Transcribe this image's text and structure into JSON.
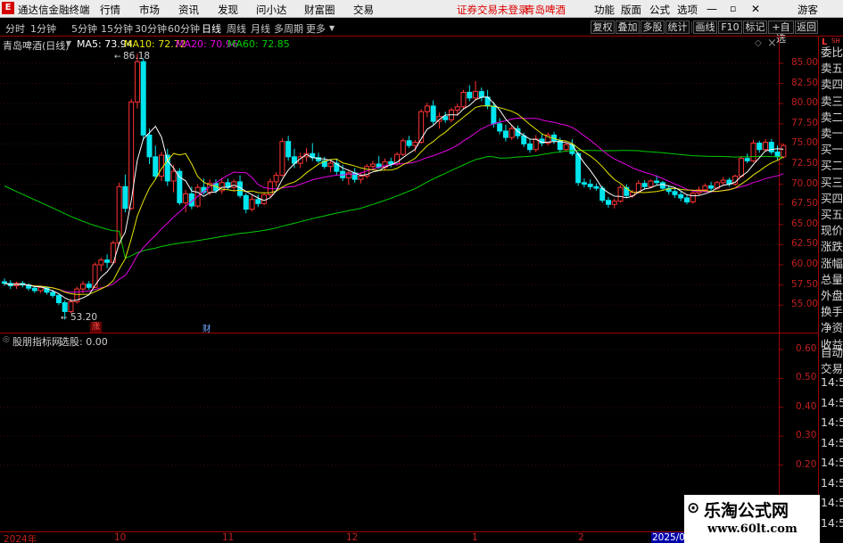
{
  "app": {
    "title": "通达信金融终端",
    "menu": [
      "行情",
      "市场",
      "资讯",
      "发现",
      "问小达",
      "财富圈",
      "交易"
    ],
    "notice": "证券交易未登录",
    "stock_name_header": "青岛啤酒",
    "right_menu": [
      "功能",
      "版面",
      "公式",
      "选项"
    ],
    "guest": "游客"
  },
  "toolbar": {
    "periods": [
      "分时",
      "1分钟",
      "5分钟",
      "15分钟",
      "30分钟",
      "60分钟",
      "日线",
      "周线",
      "月线",
      "多周期",
      "更多"
    ],
    "active_period": "日线",
    "right_buttons": [
      "复权",
      "叠加",
      "多股",
      "统计",
      "画线",
      "F10",
      "标记",
      "+自选",
      "返回"
    ]
  },
  "chart_info": {
    "stock": "青岛啤酒(日线)",
    "ma5": "MA5: 73.94",
    "ma10": "MA10: 72.72",
    "ma20": "MA20: 70.96",
    "ma60": "MA60: 72.85",
    "colors": {
      "ma5": "#ffffff",
      "ma10": "#e6e600",
      "ma20": "#e600e6",
      "ma60": "#00cc00",
      "up": "#ff3333",
      "down": "#00e5ee"
    },
    "high_mark": "86.18",
    "low_mark": "53.20",
    "event_up": "涨",
    "event_fin": "财"
  },
  "indicator": {
    "name": "股朋指标网",
    "value": "选股: 0.00"
  },
  "chart_data": [
    {
      "type": "candlestick",
      "title": "青岛啤酒(日线)",
      "yticks": [
        "85.00",
        "82.50",
        "80.00",
        "77.50",
        "75.00",
        "72.50",
        "70.00",
        "67.50",
        "65.00",
        "62.50",
        "60.00",
        "57.50",
        "55.00"
      ],
      "xlabels": [
        "2024年",
        "10",
        "11",
        "12",
        "1",
        "2",
        "2025/02"
      ],
      "series": [
        {
          "name": "MA5",
          "value": "73.94"
        },
        {
          "name": "MA10",
          "value": "72.72"
        },
        {
          "name": "MA20",
          "value": "70.96"
        },
        {
          "name": "MA60",
          "value": "72.85"
        }
      ],
      "candles": [
        [
          57.9,
          58.3,
          57.4,
          57.7
        ],
        [
          57.7,
          58.1,
          57.0,
          57.4
        ],
        [
          57.4,
          57.9,
          57.0,
          57.7
        ],
        [
          57.7,
          58.0,
          57.2,
          57.5
        ],
        [
          57.5,
          57.7,
          56.8,
          57.1
        ],
        [
          57.1,
          57.4,
          56.5,
          56.8
        ],
        [
          56.8,
          57.4,
          56.5,
          57.2
        ],
        [
          57.2,
          57.3,
          56.3,
          56.6
        ],
        [
          56.6,
          56.9,
          55.9,
          56.2
        ],
        [
          56.2,
          56.4,
          55.0,
          55.3
        ],
        [
          55.3,
          55.6,
          53.2,
          54.2
        ],
        [
          54.2,
          55.8,
          54.0,
          55.4
        ],
        [
          55.4,
          57.3,
          55.2,
          57.0
        ],
        [
          57.0,
          58.0,
          56.5,
          57.6
        ],
        [
          57.6,
          58.0,
          56.9,
          57.2
        ],
        [
          57.2,
          60.3,
          57.1,
          60.0
        ],
        [
          60.0,
          60.9,
          59.2,
          60.6
        ],
        [
          60.6,
          61.3,
          59.6,
          60.3
        ],
        [
          60.3,
          63.0,
          60.1,
          62.7
        ],
        [
          62.7,
          70.2,
          62.4,
          69.7
        ],
        [
          69.7,
          71.2,
          66.5,
          67.0
        ],
        [
          67.0,
          80.6,
          66.8,
          80.2
        ],
        [
          80.2,
          86.18,
          79.4,
          85.2
        ],
        [
          85.2,
          85.6,
          75.4,
          76.1
        ],
        [
          76.1,
          76.9,
          72.5,
          73.4
        ],
        [
          73.4,
          74.8,
          70.6,
          71.0
        ],
        [
          71.0,
          74.0,
          70.4,
          73.6
        ],
        [
          73.6,
          74.4,
          69.8,
          70.4
        ],
        [
          70.4,
          72.4,
          69.0,
          71.6
        ],
        [
          71.6,
          72.0,
          67.4,
          67.7
        ],
        [
          67.7,
          69.3,
          66.5,
          68.8
        ],
        [
          68.8,
          69.7,
          66.9,
          67.3
        ],
        [
          67.3,
          70.0,
          67.1,
          69.6
        ],
        [
          69.6,
          70.7,
          68.7,
          69.0
        ],
        [
          69.0,
          70.6,
          68.6,
          70.1
        ],
        [
          70.1,
          70.6,
          68.9,
          69.2
        ],
        [
          69.2,
          70.8,
          68.8,
          70.2
        ],
        [
          70.2,
          70.7,
          69.3,
          69.6
        ],
        [
          69.6,
          70.6,
          69.1,
          70.3
        ],
        [
          70.3,
          71.1,
          68.3,
          68.6
        ],
        [
          68.6,
          68.9,
          66.4,
          66.9
        ],
        [
          66.9,
          68.6,
          66.6,
          68.1
        ],
        [
          68.1,
          68.7,
          67.2,
          67.6
        ],
        [
          67.6,
          69.0,
          67.4,
          68.7
        ],
        [
          68.7,
          70.7,
          68.4,
          70.3
        ],
        [
          70.3,
          71.5,
          69.7,
          71.1
        ],
        [
          71.1,
          75.7,
          70.9,
          75.3
        ],
        [
          75.3,
          76.0,
          72.9,
          73.4
        ],
        [
          73.4,
          74.4,
          72.0,
          72.6
        ],
        [
          72.6,
          73.9,
          72.0,
          73.4
        ],
        [
          73.4,
          74.5,
          72.8,
          73.8
        ],
        [
          73.8,
          75.1,
          72.9,
          73.3
        ],
        [
          73.3,
          73.9,
          72.6,
          72.9
        ],
        [
          72.9,
          73.4,
          71.9,
          72.2
        ],
        [
          72.2,
          73.0,
          71.5,
          72.6
        ],
        [
          72.6,
          73.2,
          71.2,
          71.6
        ],
        [
          71.6,
          72.4,
          70.4,
          70.8
        ],
        [
          70.8,
          71.8,
          69.9,
          71.4
        ],
        [
          71.4,
          72.0,
          70.2,
          70.6
        ],
        [
          70.6,
          71.5,
          70.1,
          71.0
        ],
        [
          71.0,
          72.5,
          70.7,
          72.2
        ],
        [
          72.2,
          72.9,
          71.8,
          72.5
        ],
        [
          72.5,
          73.5,
          71.9,
          72.1
        ],
        [
          72.1,
          73.2,
          71.7,
          72.8
        ],
        [
          72.8,
          73.3,
          72.1,
          72.5
        ],
        [
          72.5,
          74.0,
          72.3,
          73.7
        ],
        [
          73.7,
          75.7,
          73.5,
          75.4
        ],
        [
          75.4,
          76.0,
          74.5,
          74.8
        ],
        [
          74.8,
          75.5,
          74.0,
          75.2
        ],
        [
          75.2,
          79.3,
          75.0,
          79.0
        ],
        [
          79.0,
          80.1,
          78.3,
          79.7
        ],
        [
          79.7,
          80.4,
          77.4,
          77.8
        ],
        [
          77.8,
          78.9,
          76.9,
          78.4
        ],
        [
          78.4,
          79.0,
          77.6,
          78.0
        ],
        [
          78.0,
          79.5,
          77.7,
          79.2
        ],
        [
          79.2,
          80.0,
          78.5,
          79.6
        ],
        [
          79.6,
          81.7,
          79.3,
          81.4
        ],
        [
          81.4,
          82.3,
          80.3,
          80.7
        ],
        [
          80.7,
          82.8,
          80.4,
          81.5
        ],
        [
          81.5,
          82.0,
          80.3,
          80.8
        ],
        [
          80.8,
          81.7,
          79.3,
          79.7
        ],
        [
          79.7,
          80.2,
          77.0,
          77.5
        ],
        [
          77.5,
          78.2,
          76.2,
          76.6
        ],
        [
          76.6,
          77.4,
          75.3,
          75.8
        ],
        [
          75.8,
          77.2,
          75.5,
          76.9
        ],
        [
          76.9,
          77.3,
          75.6,
          76.0
        ],
        [
          76.0,
          76.4,
          74.6,
          75.0
        ],
        [
          75.0,
          75.6,
          73.9,
          74.3
        ],
        [
          74.3,
          76.1,
          74.0,
          75.6
        ],
        [
          75.6,
          76.2,
          74.7,
          75.1
        ],
        [
          75.1,
          76.4,
          74.8,
          76.1
        ],
        [
          76.1,
          76.5,
          75.0,
          75.4
        ],
        [
          75.4,
          75.8,
          73.9,
          74.3
        ],
        [
          74.3,
          75.2,
          74.0,
          74.9
        ],
        [
          74.9,
          75.6,
          73.5,
          73.8
        ],
        [
          73.8,
          74.0,
          69.8,
          70.2
        ],
        [
          70.2,
          70.7,
          69.6,
          70.0
        ],
        [
          70.0,
          70.6,
          69.3,
          69.7
        ],
        [
          69.7,
          70.1,
          69.2,
          69.5
        ],
        [
          69.5,
          69.8,
          67.7,
          68.0
        ],
        [
          68.0,
          68.4,
          67.1,
          67.5
        ],
        [
          67.5,
          68.2,
          67.0,
          67.9
        ],
        [
          67.9,
          69.9,
          67.7,
          69.6
        ],
        [
          69.6,
          70.0,
          68.3,
          68.6
        ],
        [
          68.6,
          69.3,
          68.3,
          69.0
        ],
        [
          69.0,
          70.5,
          68.8,
          70.1
        ],
        [
          70.1,
          70.5,
          69.4,
          69.7
        ],
        [
          69.7,
          70.6,
          69.5,
          70.4
        ],
        [
          70.4,
          71.1,
          69.9,
          70.2
        ],
        [
          70.2,
          70.4,
          69.2,
          69.5
        ],
        [
          69.5,
          69.8,
          68.7,
          69.1
        ],
        [
          69.1,
          69.4,
          68.3,
          68.7
        ],
        [
          68.7,
          69.1,
          67.9,
          68.3
        ],
        [
          68.3,
          68.6,
          67.5,
          67.8
        ],
        [
          67.8,
          69.2,
          67.6,
          68.9
        ],
        [
          68.9,
          69.7,
          68.6,
          69.3
        ],
        [
          69.3,
          70.1,
          69.0,
          69.8
        ],
        [
          69.8,
          70.3,
          69.1,
          69.5
        ],
        [
          69.5,
          70.4,
          69.3,
          70.2
        ],
        [
          70.2,
          70.9,
          69.8,
          70.5
        ],
        [
          70.5,
          70.8,
          69.7,
          70.0
        ],
        [
          70.0,
          71.2,
          69.8,
          71.0
        ],
        [
          71.0,
          73.5,
          70.8,
          73.2
        ],
        [
          73.2,
          73.8,
          72.6,
          72.9
        ],
        [
          72.9,
          75.5,
          72.7,
          75.1
        ],
        [
          75.1,
          75.4,
          73.9,
          74.3
        ],
        [
          74.3,
          75.6,
          74.0,
          75.2
        ],
        [
          75.2,
          75.6,
          73.7,
          74.0
        ],
        [
          74.0,
          74.8,
          72.9,
          73.4
        ],
        [
          73.4,
          75.0,
          73.2,
          74.8
        ]
      ]
    },
    {
      "type": "line",
      "title": "股朋指标网",
      "yticks": [
        "0.60",
        "0.50",
        "0.40",
        "0.30",
        "0.20"
      ],
      "series": [
        {
          "name": "选股",
          "value": "0.00"
        }
      ]
    }
  ],
  "side_panel": {
    "labels": [
      "委比",
      "卖五",
      "卖四",
      "卖三",
      "卖二",
      "卖一",
      "买一",
      "买二",
      "买三",
      "买四",
      "买五",
      "现价",
      "涨跌",
      "涨幅",
      "总量",
      "外盘",
      "换手",
      "净资",
      "收益"
    ],
    "lower": [
      "自动",
      "交易"
    ],
    "times": [
      "14:56",
      "14:56",
      "14:56",
      "14:56",
      "14:56",
      "14:56",
      "14:56",
      "14:56"
    ],
    "corner": "L"
  },
  "watermark": {
    "line1": "乐淘公式网",
    "line2": "www.60lt.com"
  }
}
